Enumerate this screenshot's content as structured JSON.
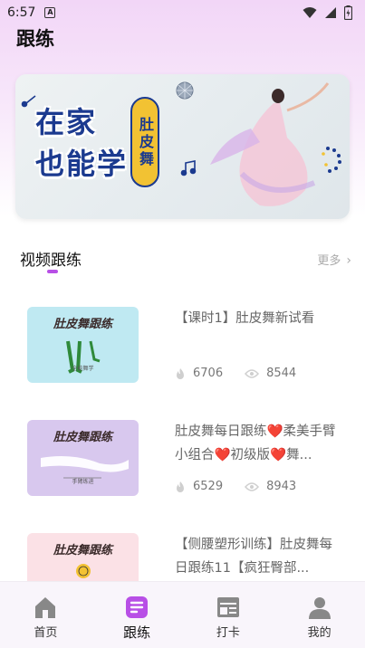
{
  "status_bar": {
    "time": "6:57",
    "notif_letter": "A"
  },
  "page": {
    "title": "跟练"
  },
  "banner": {
    "title_line1": "在家",
    "title_line2": "也能学",
    "pill_text": "肚皮舞"
  },
  "section": {
    "title": "视频跟练",
    "more_label": "更多",
    "more_chevron": "›"
  },
  "videos": [
    {
      "title": "【课时1】肚皮舞新试看",
      "thumb_title": "肚皮舞跟练",
      "thumb_sub": "全能舞学",
      "likes": "6706",
      "views": "8544",
      "thumb_bg": "#bfe9f2"
    },
    {
      "title": "肚皮舞每日跟练❤️柔美手臂小组合❤️初级版❤️舞...",
      "thumb_title": "肚皮舞跟练",
      "thumb_sub": "手臂练进",
      "likes": "6529",
      "views": "8943",
      "thumb_bg": "#d8c8ee"
    },
    {
      "title": "【侧腰塑形训练】肚皮舞每日跟练11【疯狂臀部...",
      "thumb_title": "肚皮舞跟练",
      "thumb_sub": "",
      "likes": "",
      "views": "",
      "thumb_bg": "#fbe1e6"
    }
  ],
  "bottom_nav": [
    {
      "label": "首页",
      "icon": "home-icon",
      "active": false
    },
    {
      "label": "跟练",
      "icon": "practice-icon",
      "active": true
    },
    {
      "label": "打卡",
      "icon": "checkin-icon",
      "active": false
    },
    {
      "label": "我的",
      "icon": "profile-icon",
      "active": false
    }
  ],
  "colors": {
    "accent": "#b84fe6",
    "banner_blue": "#1b3a8f",
    "pill_yellow": "#f2c233"
  }
}
